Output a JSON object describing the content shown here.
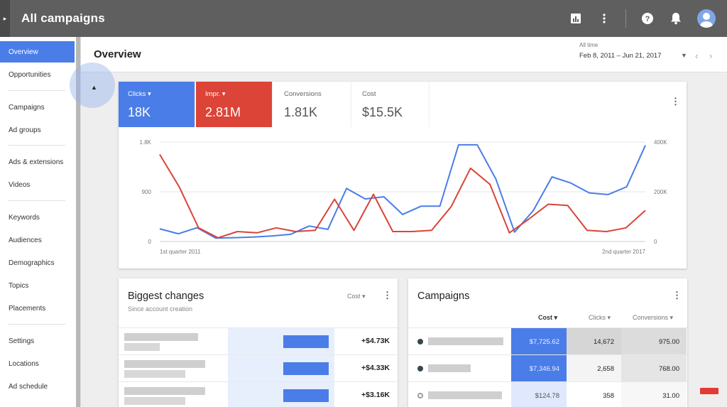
{
  "topbar": {
    "title": "All campaigns",
    "toggle_icon": "chevron-right-icon"
  },
  "sidebar": {
    "items": [
      {
        "label": "Overview",
        "active": true
      },
      {
        "label": "Opportunities"
      },
      {
        "label": "Campaigns"
      },
      {
        "label": "Ad groups"
      },
      {
        "label": "Ads & extensions"
      },
      {
        "label": "Videos"
      },
      {
        "label": "Keywords"
      },
      {
        "label": "Audiences"
      },
      {
        "label": "Demographics"
      },
      {
        "label": "Topics"
      },
      {
        "label": "Placements"
      },
      {
        "label": "Settings"
      },
      {
        "label": "Locations"
      },
      {
        "label": "Ad schedule"
      }
    ]
  },
  "header": {
    "title": "Overview",
    "date_label": "All time",
    "date_range": "Feb 8, 2011 – Jun 21, 2017"
  },
  "metrics": {
    "clicks": {
      "label": "Clicks ▾",
      "value": "18K"
    },
    "impr": {
      "label": "Impr. ▾",
      "value": "2.81M"
    },
    "conversions": {
      "label": "Conversions",
      "value": "1.81K"
    },
    "cost": {
      "label": "Cost",
      "value": "$15.5K"
    }
  },
  "chart_data": {
    "type": "line",
    "x_labels": [
      "1st quarter 2011",
      "2nd quarter 2017"
    ],
    "y_left_ticks": [
      "1.8K",
      "900",
      "0"
    ],
    "y_right_ticks": [
      "400K",
      "200K",
      "0"
    ],
    "ylim_left": [
      0,
      1800
    ],
    "ylim_right": [
      0,
      400000
    ],
    "grid": true,
    "series": [
      {
        "name": "Clicks",
        "axis": "left",
        "color": "#4a7de8",
        "values": [
          230,
          140,
          250,
          60,
          70,
          80,
          100,
          130,
          280,
          220,
          960,
          770,
          810,
          490,
          640,
          640,
          1750,
          1750,
          1130,
          170,
          560,
          1170,
          1060,
          880,
          850,
          990,
          1740
        ]
      },
      {
        "name": "Impr.",
        "axis": "right",
        "color": "#db4437",
        "values": [
          350000,
          220000,
          55000,
          15000,
          40000,
          35000,
          55000,
          40000,
          45000,
          170000,
          45000,
          190000,
          40000,
          40000,
          45000,
          140000,
          295000,
          230000,
          35000,
          90000,
          150000,
          145000,
          45000,
          40000,
          55000,
          125000
        ]
      }
    ]
  },
  "biggest_changes": {
    "title": "Biggest changes",
    "subtitle": "Since account creation",
    "sort_label": "Cost ▾",
    "rows": [
      {
        "value": "+$4.73K"
      },
      {
        "value": "+$4.33K"
      },
      {
        "value": "+$3.16K"
      }
    ]
  },
  "campaigns": {
    "title": "Campaigns",
    "headers": {
      "cost": "Cost ▾",
      "clicks": "Clicks ▾",
      "conversions": "Conversions ▾"
    },
    "rows": [
      {
        "cost": "$7,725.62",
        "clicks": "14,672",
        "conversions": "975.00",
        "cost_bg": "#4a7de8",
        "cost_fg": "#e8efff",
        "clicks_bg": "#d6d6d6",
        "conv_bg": "#dcdcdc",
        "status": "enabled"
      },
      {
        "cost": "$7,346.94",
        "clicks": "2,658",
        "conversions": "768.00",
        "cost_bg": "#4a7de8",
        "cost_fg": "#e8efff",
        "clicks_bg": "#f4f4f4",
        "conv_bg": "#e5e5e5",
        "status": "enabled"
      },
      {
        "cost": "$124.78",
        "clicks": "358",
        "conversions": "31.00",
        "cost_bg": "#dfe8fc",
        "cost_fg": "#555555",
        "clicks_bg": "#ffffff",
        "conv_bg": "#f7f7f7",
        "status": "paused"
      }
    ]
  }
}
